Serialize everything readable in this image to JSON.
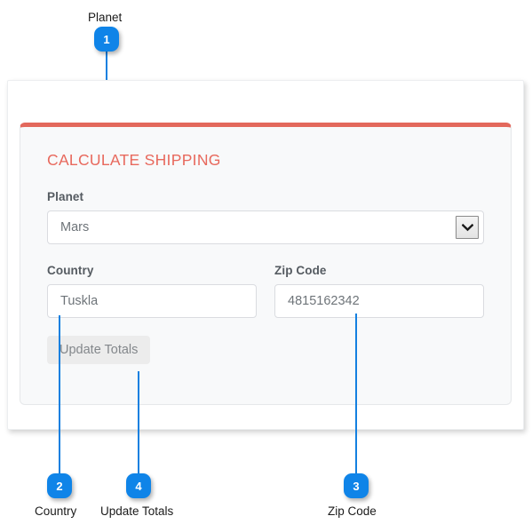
{
  "form": {
    "title": "CALCULATE SHIPPING",
    "planet": {
      "label": "Planet",
      "value": "Mars",
      "icon": "chevron-down-icon"
    },
    "country": {
      "label": "Country",
      "value": "Tuskla"
    },
    "zip": {
      "label": "Zip Code",
      "value": "4815162342"
    },
    "update_button": "Update Totals"
  },
  "callouts": [
    {
      "number": "1",
      "label": "Planet",
      "position": "top"
    },
    {
      "number": "2",
      "label": "Country",
      "position": "bottom"
    },
    {
      "number": "3",
      "label": "Zip Code",
      "position": "bottom"
    },
    {
      "number": "4",
      "label": "Update Totals",
      "position": "bottom"
    }
  ],
  "colors": {
    "accent_red": "#e8695d",
    "callout_blue": "#0f84e8",
    "card_background": "#f8f9fa",
    "label_gray": "#555b61",
    "value_gray": "#6e7479"
  }
}
